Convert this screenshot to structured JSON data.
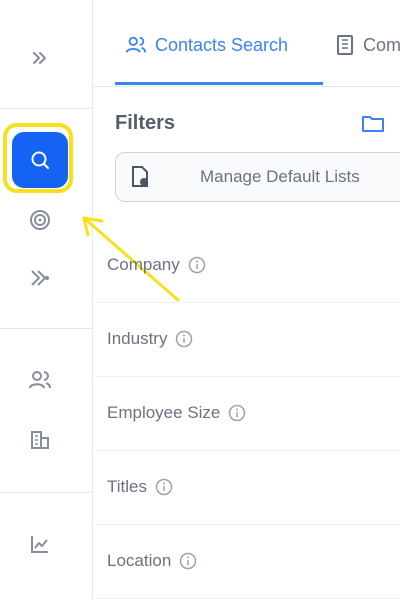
{
  "sidebar": {
    "expand_icon": "chevrons-right-icon",
    "active_item": "search",
    "items": [
      {
        "id": "search",
        "icon": "search-icon"
      },
      {
        "id": "target",
        "icon": "target-icon"
      },
      {
        "id": "sequence",
        "icon": "sequence-arrow-icon"
      },
      {
        "id": "people",
        "icon": "people-icon"
      },
      {
        "id": "companies",
        "icon": "building-icon"
      },
      {
        "id": "analytics",
        "icon": "chart-icon"
      }
    ]
  },
  "tabs": [
    {
      "label": "Contacts Search",
      "icon": "users-icon",
      "active": true
    },
    {
      "label": "Com",
      "icon": "building-icon",
      "active": false
    }
  ],
  "filters": {
    "title": "Filters",
    "manage_button_label": "Manage Default Lists",
    "rows": [
      {
        "label": "Company"
      },
      {
        "label": "Industry"
      },
      {
        "label": "Employee Size"
      },
      {
        "label": "Titles"
      },
      {
        "label": "Location"
      }
    ]
  },
  "colors": {
    "accent": "#1463f3",
    "tab_active": "#3b82f6",
    "highlight": "#f5e11c"
  }
}
